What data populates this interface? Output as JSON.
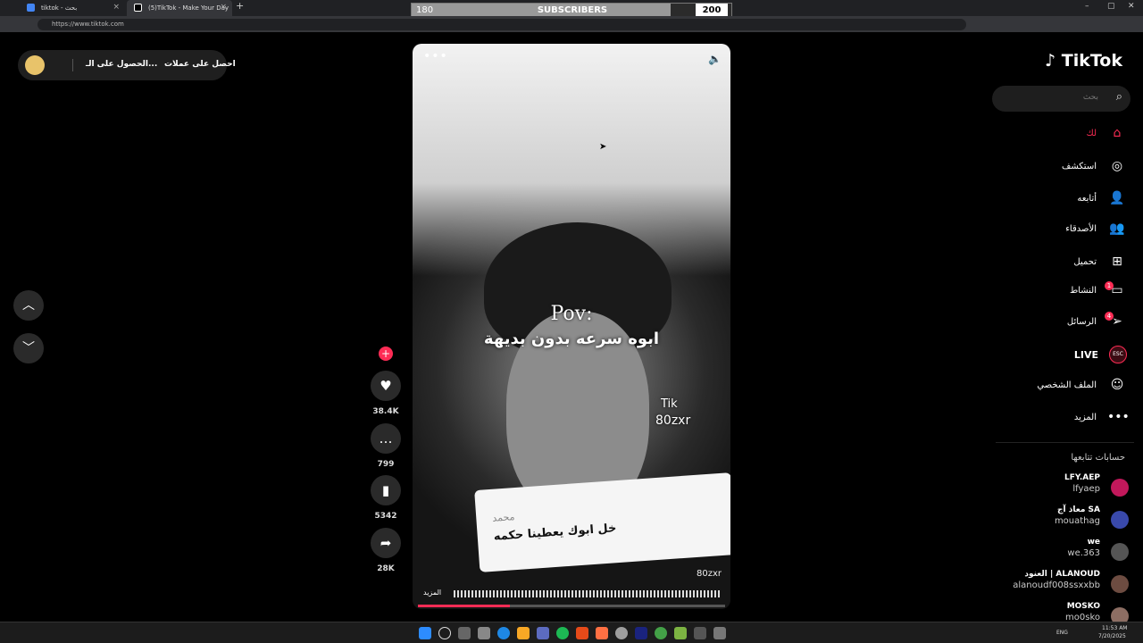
{
  "browser": {
    "tabs": [
      {
        "label": "tiktok - بحث"
      },
      {
        "label": "(5)TikTok - Make Your Day"
      }
    ],
    "url": "https://www.tiktok.com"
  },
  "overlay": {
    "label": "SUBSCRIBERS",
    "current": "180",
    "goal": "200",
    "progress": 0.9
  },
  "promo": {
    "coins": "احصل على عملات",
    "app": "الحصول على الـ..."
  },
  "video": {
    "pov": "Pov:",
    "caption": "ابوه سرعه بدون بديهة",
    "card_name": "محمد",
    "card_quote": "خل ابوك يعطينا حكمه",
    "watermark_top": "Tik",
    "watermark_mid": "80zxr",
    "watermark_bottom": "80zxr",
    "more_label": "المزيد",
    "progress": 0.3
  },
  "actions": {
    "likes": "38.4K",
    "comments": "799",
    "saves": "5342",
    "shares": "28K"
  },
  "sidebar": {
    "logo": "TikTok",
    "search_placeholder": "بحث",
    "items": [
      {
        "label": "لك",
        "icon": "home-icon",
        "color": "#fe2c55"
      },
      {
        "label": "استكشف",
        "icon": "compass-icon"
      },
      {
        "label": "أتابعه",
        "icon": "follow-icon"
      },
      {
        "label": "الأصدقاء",
        "icon": "friends-icon"
      },
      {
        "label": "تحميل",
        "icon": "upload-icon"
      },
      {
        "label": "النشاط",
        "icon": "activity-icon",
        "badge": "1"
      },
      {
        "label": "الرسائل",
        "icon": "messages-icon",
        "badge": "4"
      },
      {
        "label": "LIVE",
        "icon": "live-icon"
      },
      {
        "label": "الملف الشخصي",
        "icon": "profile-icon"
      },
      {
        "label": "المزيد",
        "icon": "more-icon"
      }
    ],
    "following_header": "حسابات تتابعها",
    "following": [
      {
        "name": "LFY.AEP",
        "user": "lfyaep"
      },
      {
        "name": "معاذ آج SA",
        "user": "mouathag"
      },
      {
        "name": "we",
        "user": "we.363"
      },
      {
        "name": "العنود | ALANOUD",
        "user": "alanoudf008ssxxbb"
      },
      {
        "name": "MOSKO",
        "user": "mo0sko"
      }
    ]
  },
  "taskbar": {
    "lang": "ENG",
    "time": "11:53 AM",
    "date": "7/20/2025"
  }
}
